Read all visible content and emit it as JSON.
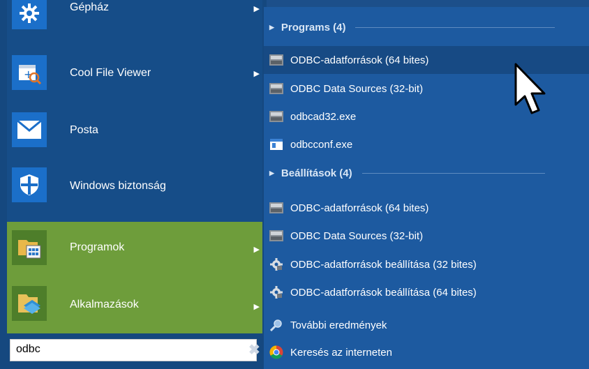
{
  "pinned": [
    {
      "label": "Gépház",
      "icon": "gear-icon",
      "has_arrow": true
    },
    {
      "label": "Cool File Viewer",
      "icon": "file-viewer-icon",
      "has_arrow": true
    },
    {
      "label": "Posta",
      "icon": "mail-icon",
      "has_arrow": false
    },
    {
      "label": "Windows biztonság",
      "icon": "shield-icon",
      "has_arrow": false
    },
    {
      "label": "Programok",
      "icon": "programs-folder-icon",
      "has_arrow": true
    },
    {
      "label": "Alkalmazások",
      "icon": "apps-folder-icon",
      "has_arrow": true
    }
  ],
  "search": {
    "value": "odbc",
    "clear_label": "✖"
  },
  "results": {
    "programs_header": "Programs (4)",
    "programs": [
      {
        "label": "ODBC-adatforrások (64 bites)",
        "icon": "odbc-icon"
      },
      {
        "label": "ODBC Data Sources (32-bit)",
        "icon": "odbc-icon"
      },
      {
        "label": "odbcad32.exe",
        "icon": "odbc-icon"
      },
      {
        "label": "odbcconf.exe",
        "icon": "exe-icon"
      }
    ],
    "settings_header": "Beállítások (4)",
    "settings": [
      {
        "label": "ODBC-adatforrások (64 bites)",
        "icon": "odbc-icon"
      },
      {
        "label": "ODBC Data Sources (32-bit)",
        "icon": "odbc-icon"
      },
      {
        "label": "ODBC-adatforrások beállítása (32 bites)",
        "icon": "settings-cog-icon"
      },
      {
        "label": "ODBC-adatforrások beállítása (64 bites)",
        "icon": "settings-cog-icon"
      }
    ],
    "more_results": "További eredmények",
    "search_internet": "Keresés az interneten"
  }
}
